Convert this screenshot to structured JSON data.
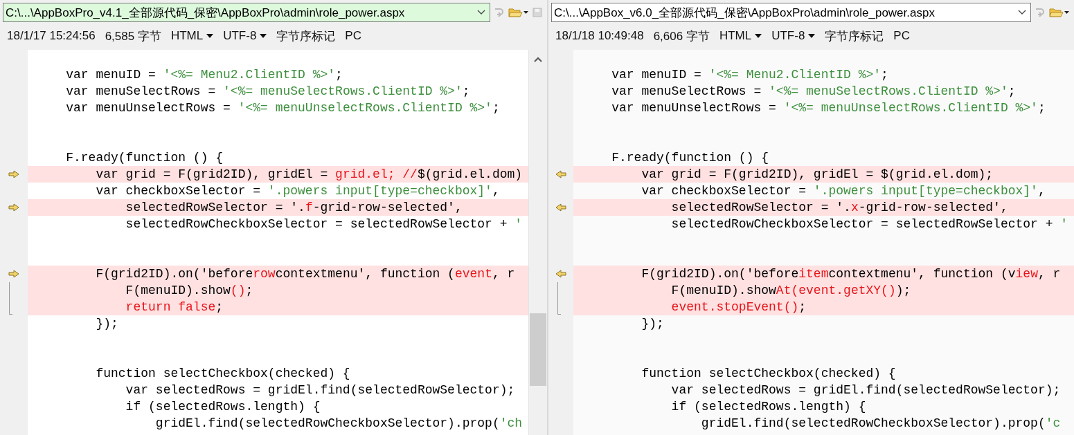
{
  "panes": [
    {
      "kind": "left",
      "path": "C:\\...\\AppBoxPro_v4.1_全部源代码_保密\\AppBoxPro\\admin\\role_power.aspx",
      "path_highlight": true,
      "status": [
        {
          "text": "18/1/17 15:24:56",
          "dropdown": false
        },
        {
          "text": "6,585 字节",
          "dropdown": false
        },
        {
          "text": "HTML",
          "dropdown": true
        },
        {
          "text": "UTF-8",
          "dropdown": true
        },
        {
          "text": "字节序标记",
          "dropdown": false
        },
        {
          "text": "PC",
          "dropdown": false
        }
      ],
      "lines": [
        {
          "kind": "blank"
        },
        {
          "kind": "same",
          "segments": [
            {
              "kind": "plain",
              "text": "    var menuID = "
            },
            {
              "kind": "string",
              "text": "'<%= Menu2.ClientID %>'"
            },
            {
              "kind": "plain",
              "text": ";"
            }
          ]
        },
        {
          "kind": "same",
          "segments": [
            {
              "kind": "plain",
              "text": "    var menuSelectRows = "
            },
            {
              "kind": "string",
              "text": "'<%= menuSelectRows.ClientID %>'"
            },
            {
              "kind": "plain",
              "text": ";"
            }
          ]
        },
        {
          "kind": "same",
          "segments": [
            {
              "kind": "plain",
              "text": "    var menuUnselectRows = "
            },
            {
              "kind": "string",
              "text": "'<%= menuUnselectRows.ClientID %>'"
            },
            {
              "kind": "plain",
              "text": ";"
            }
          ]
        },
        {
          "kind": "blank"
        },
        {
          "kind": "blank"
        },
        {
          "kind": "same",
          "segments": [
            {
              "kind": "plain",
              "text": "    F.ready(function () {"
            }
          ]
        },
        {
          "kind": "change_start",
          "segments": [
            {
              "kind": "plain",
              "text": "        var grid = F(grid2ID), gridEl = "
            },
            {
              "kind": "changed",
              "text": "grid.el; //"
            },
            {
              "kind": "plain",
              "text": "$(grid.el.dom)"
            }
          ]
        },
        {
          "kind": "same",
          "segments": [
            {
              "kind": "plain",
              "text": "        var checkboxSelector = "
            },
            {
              "kind": "string",
              "text": "'.powers input[type=checkbox]'"
            },
            {
              "kind": "plain",
              "text": ","
            }
          ]
        },
        {
          "kind": "change_start",
          "segments": [
            {
              "kind": "plain",
              "text": "            selectedRowSelector = '."
            },
            {
              "kind": "changed",
              "text": "f"
            },
            {
              "kind": "plain",
              "text": "-grid-row-selected',"
            }
          ]
        },
        {
          "kind": "same",
          "segments": [
            {
              "kind": "plain",
              "text": "            selectedRowCheckboxSelector = selectedRowSelector + "
            },
            {
              "kind": "string",
              "text": "'"
            }
          ]
        },
        {
          "kind": "blank"
        },
        {
          "kind": "blank"
        },
        {
          "kind": "change_start",
          "segments": [
            {
              "kind": "plain",
              "text": "        F(grid2ID).on('before"
            },
            {
              "kind": "changed",
              "text": "row"
            },
            {
              "kind": "plain",
              "text": "contextmenu', function ("
            },
            {
              "kind": "changed",
              "text": "event"
            },
            {
              "kind": "plain",
              "text": ", r"
            }
          ]
        },
        {
          "kind": "change",
          "segments": [
            {
              "kind": "plain",
              "text": "            F(menuID).show"
            },
            {
              "kind": "changed",
              "text": "()"
            },
            {
              "kind": "plain",
              "text": ";"
            }
          ]
        },
        {
          "kind": "change",
          "segments": [
            {
              "kind": "changed",
              "text": "            return false"
            },
            {
              "kind": "plain",
              "text": ";"
            }
          ]
        },
        {
          "kind": "same",
          "segments": [
            {
              "kind": "plain",
              "text": "        });"
            }
          ]
        },
        {
          "kind": "blank"
        },
        {
          "kind": "blank"
        },
        {
          "kind": "same",
          "segments": [
            {
              "kind": "plain",
              "text": "        function selectCheckbox(checked) {"
            }
          ]
        },
        {
          "kind": "same",
          "segments": [
            {
              "kind": "plain",
              "text": "            var selectedRows = gridEl.find(selectedRowSelector);"
            }
          ]
        },
        {
          "kind": "same",
          "segments": [
            {
              "kind": "plain",
              "text": "            if (selectedRows.length) {"
            }
          ]
        },
        {
          "kind": "same",
          "segments": [
            {
              "kind": "plain",
              "text": "                gridEl.find(selectedRowCheckboxSelector).prop("
            },
            {
              "kind": "string",
              "text": "'ch"
            }
          ]
        }
      ]
    },
    {
      "kind": "right",
      "path": "C:\\...\\AppBox_v6.0_全部源代码_保密\\AppBoxPro\\admin\\role_power.aspx",
      "path_highlight": false,
      "status": [
        {
          "text": "18/1/18 10:49:48",
          "dropdown": false
        },
        {
          "text": "6,606 字节",
          "dropdown": false
        },
        {
          "text": "HTML",
          "dropdown": true
        },
        {
          "text": "UTF-8",
          "dropdown": true
        },
        {
          "text": "字节序标记",
          "dropdown": false
        },
        {
          "text": "PC",
          "dropdown": false
        }
      ],
      "lines": [
        {
          "kind": "blank"
        },
        {
          "kind": "same",
          "segments": [
            {
              "kind": "plain",
              "text": "    var menuID = "
            },
            {
              "kind": "string",
              "text": "'<%= Menu2.ClientID %>'"
            },
            {
              "kind": "plain",
              "text": ";"
            }
          ]
        },
        {
          "kind": "same",
          "segments": [
            {
              "kind": "plain",
              "text": "    var menuSelectRows = "
            },
            {
              "kind": "string",
              "text": "'<%= menuSelectRows.ClientID %>'"
            },
            {
              "kind": "plain",
              "text": ";"
            }
          ]
        },
        {
          "kind": "same",
          "segments": [
            {
              "kind": "plain",
              "text": "    var menuUnselectRows = "
            },
            {
              "kind": "string",
              "text": "'<%= menuUnselectRows.ClientID %>'"
            },
            {
              "kind": "plain",
              "text": ";"
            }
          ]
        },
        {
          "kind": "blank"
        },
        {
          "kind": "blank"
        },
        {
          "kind": "same",
          "segments": [
            {
              "kind": "plain",
              "text": "    F.ready(function () {"
            }
          ]
        },
        {
          "kind": "change_start",
          "segments": [
            {
              "kind": "plain",
              "text": "        var grid = F(grid2ID), gridEl = $(grid.el.dom);"
            }
          ]
        },
        {
          "kind": "same",
          "segments": [
            {
              "kind": "plain",
              "text": "        var checkboxSelector = "
            },
            {
              "kind": "string",
              "text": "'.powers input[type=checkbox]'"
            },
            {
              "kind": "plain",
              "text": ","
            }
          ]
        },
        {
          "kind": "change_start",
          "segments": [
            {
              "kind": "plain",
              "text": "            selectedRowSelector = '."
            },
            {
              "kind": "changed",
              "text": "x"
            },
            {
              "kind": "plain",
              "text": "-grid-row-selected',"
            }
          ]
        },
        {
          "kind": "same",
          "segments": [
            {
              "kind": "plain",
              "text": "            selectedRowCheckboxSelector = selectedRowSelector + "
            },
            {
              "kind": "string",
              "text": "'"
            }
          ]
        },
        {
          "kind": "blank"
        },
        {
          "kind": "blank"
        },
        {
          "kind": "change_start",
          "segments": [
            {
              "kind": "plain",
              "text": "        F(grid2ID).on('before"
            },
            {
              "kind": "changed",
              "text": "item"
            },
            {
              "kind": "plain",
              "text": "contextmenu', function (v"
            },
            {
              "kind": "changed",
              "text": "iew"
            },
            {
              "kind": "plain",
              "text": ", r"
            }
          ]
        },
        {
          "kind": "change",
          "segments": [
            {
              "kind": "plain",
              "text": "            F(menuID).show"
            },
            {
              "kind": "changed",
              "text": "At(event.getXY()"
            },
            {
              "kind": "plain",
              "text": ");"
            }
          ]
        },
        {
          "kind": "change",
          "segments": [
            {
              "kind": "changed",
              "text": "            event.stopEvent()"
            },
            {
              "kind": "plain",
              "text": ";"
            }
          ]
        },
        {
          "kind": "same",
          "segments": [
            {
              "kind": "plain",
              "text": "        });"
            }
          ]
        },
        {
          "kind": "blank"
        },
        {
          "kind": "blank"
        },
        {
          "kind": "same",
          "segments": [
            {
              "kind": "plain",
              "text": "        function selectCheckbox(checked) {"
            }
          ]
        },
        {
          "kind": "same",
          "segments": [
            {
              "kind": "plain",
              "text": "            var selectedRows = gridEl.find(selectedRowSelector);"
            }
          ]
        },
        {
          "kind": "same",
          "segments": [
            {
              "kind": "plain",
              "text": "            if (selectedRows.length) {"
            }
          ]
        },
        {
          "kind": "same",
          "segments": [
            {
              "kind": "plain",
              "text": "                gridEl.find(selectedRowCheckboxSelector).prop("
            },
            {
              "kind": "string",
              "text": "'c"
            }
          ]
        }
      ]
    }
  ]
}
